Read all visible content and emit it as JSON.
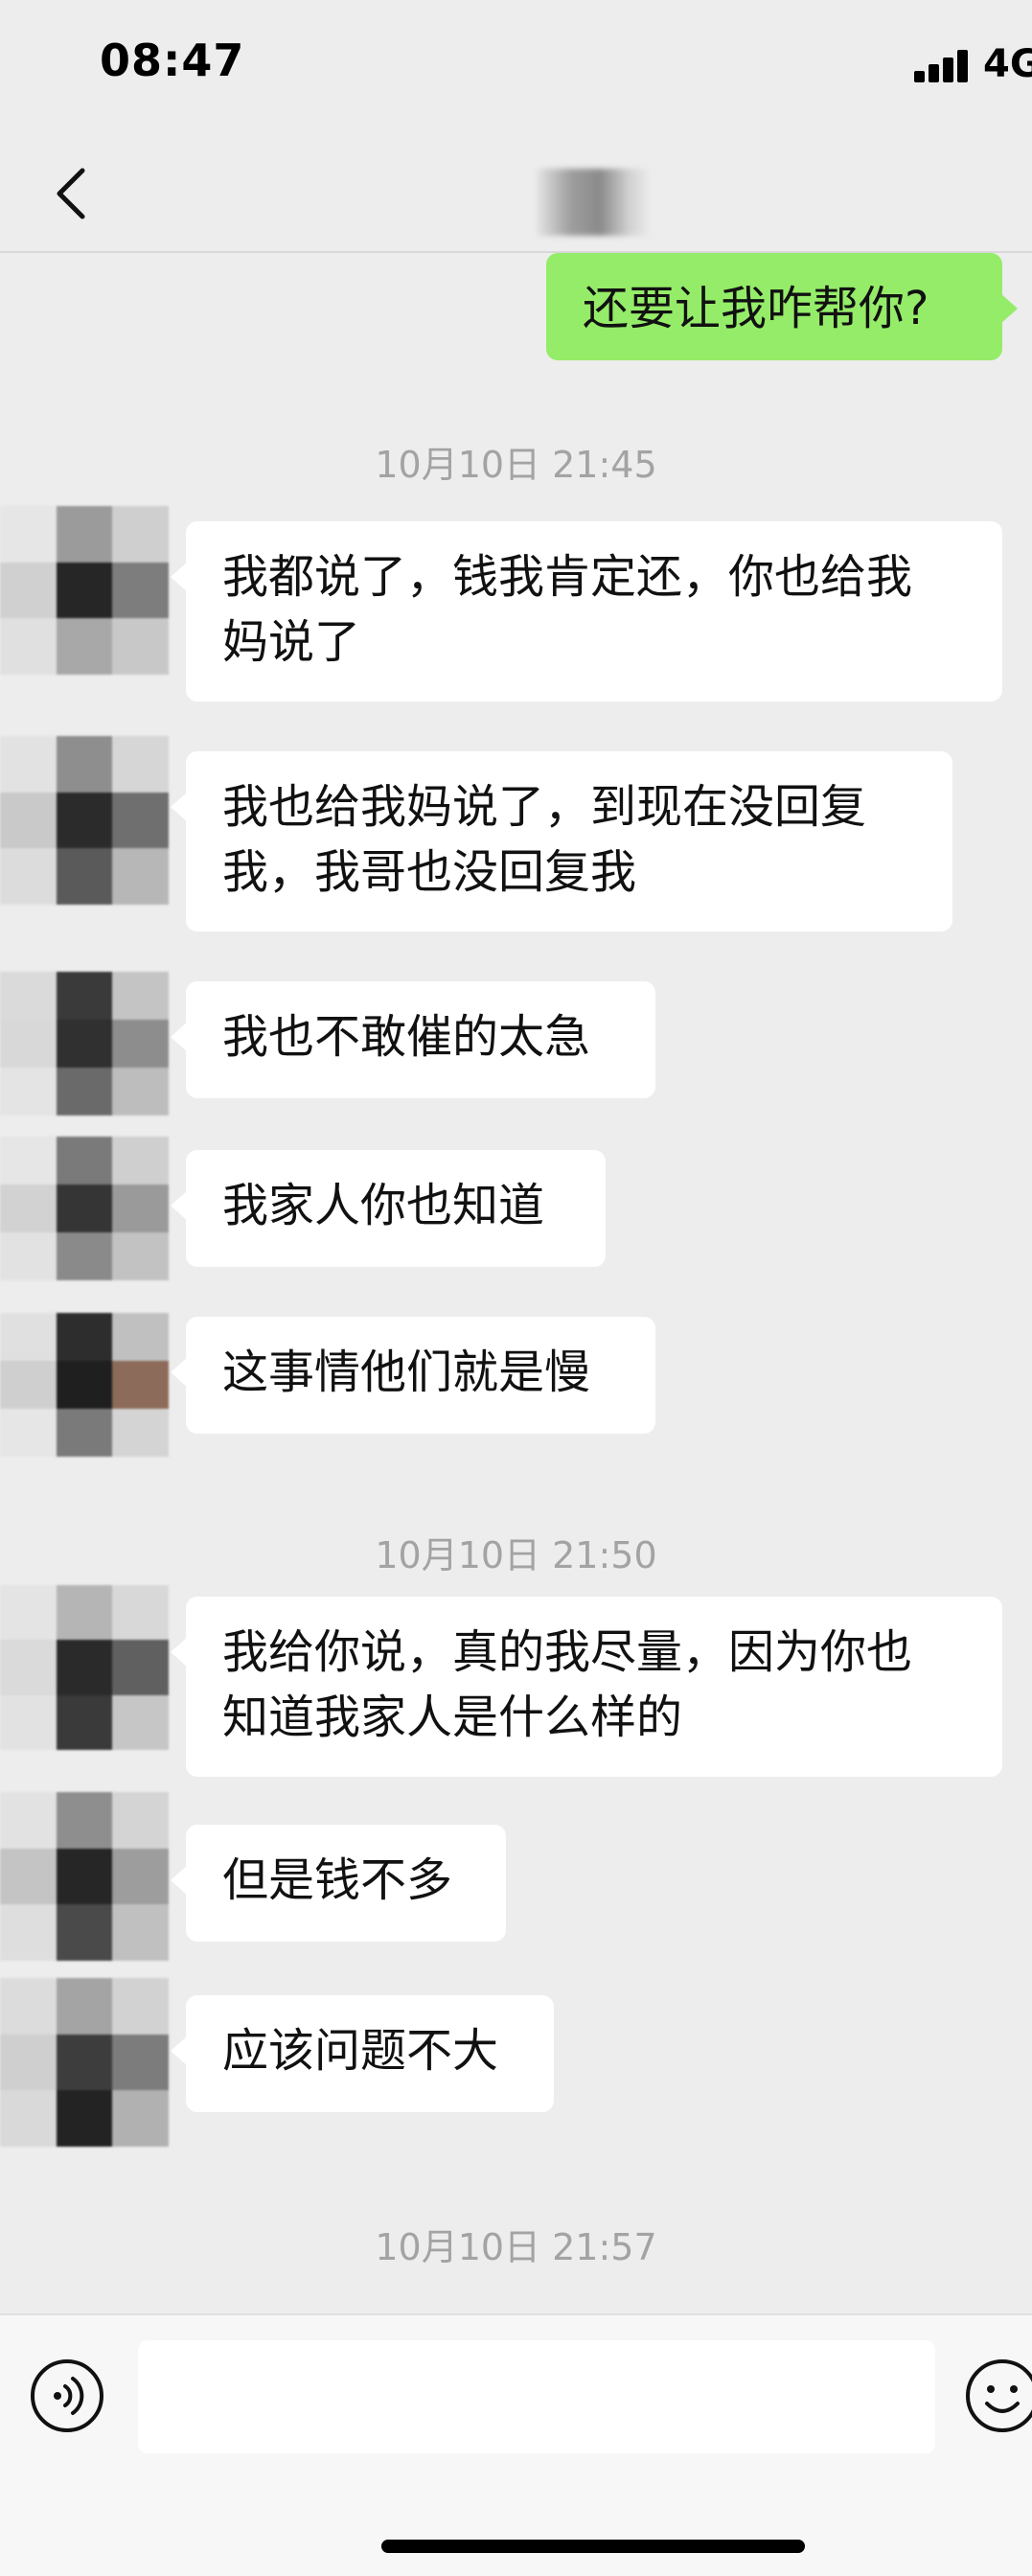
{
  "status_bar": {
    "time": "08:47",
    "network": "4G"
  },
  "header": {
    "back_icon": "chevron-left-icon",
    "contact_name": ""
  },
  "chat": {
    "outgoing_top": "还要让我咋帮你?",
    "timestamp_1": "10月10日 21:45",
    "group_1": [
      "我都说了，钱我肯定还，你也给我\n妈说了",
      "我也给我妈说了，到现在没回复\n我，我哥也没回复我",
      "我也不敢催的太急",
      "我家人你也知道",
      "这事情他们就是慢"
    ],
    "timestamp_2": "10月10日 21:50",
    "group_2": [
      "我给你说，真的我尽量，因为你也\n知道我家人是什么样的",
      "但是钱不多",
      "应该问题不大"
    ],
    "timestamp_3": "10月10日 21:57"
  },
  "input_bar": {
    "voice_icon": "voice-icon",
    "text_value": "",
    "emoji_icon": "emoji-icon"
  },
  "colors": {
    "background": "#ededed",
    "outgoing_bubble": "#95ec69",
    "incoming_bubble": "#ffffff",
    "timestamp_text": "#a3a3a3"
  }
}
